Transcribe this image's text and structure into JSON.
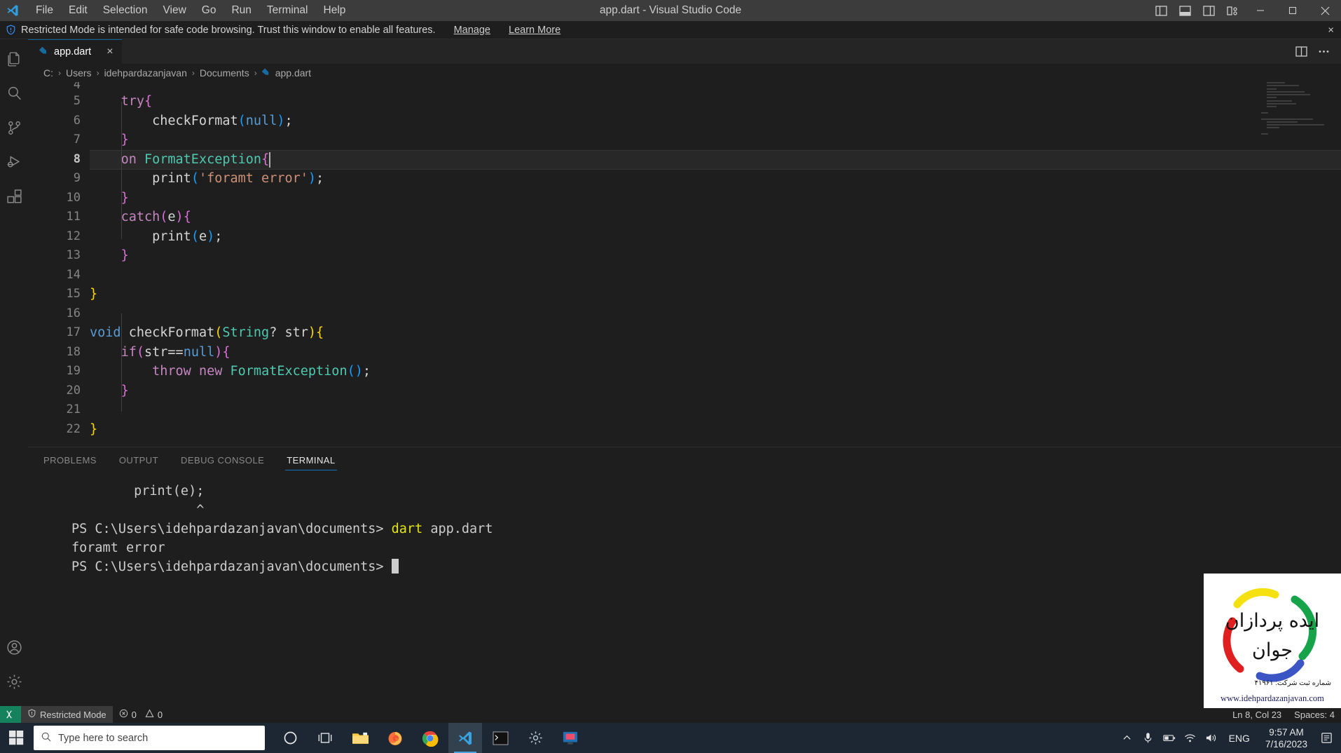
{
  "titlebar": {
    "window_title": "app.dart - Visual Studio Code",
    "menu": [
      "File",
      "Edit",
      "Selection",
      "View",
      "Go",
      "Run",
      "Terminal",
      "Help"
    ],
    "layout_icons": [
      "toggle-primary-sidebar-icon",
      "toggle-panel-icon",
      "toggle-secondary-sidebar-icon",
      "customize-layout-icon"
    ],
    "window_controls": [
      "minimize",
      "maximize",
      "close"
    ]
  },
  "notification": {
    "icon": "shield-icon",
    "message": "Restricted Mode is intended for safe code browsing. Trust this window to enable all features.",
    "manage_label": "Manage",
    "learn_more_label": "Learn More",
    "close_label": "×"
  },
  "activitybar": {
    "items": [
      {
        "name": "explorer",
        "icon": "files-icon"
      },
      {
        "name": "search",
        "icon": "search-icon"
      },
      {
        "name": "source-control",
        "icon": "source-control-icon"
      },
      {
        "name": "run-and-debug",
        "icon": "debug-icon"
      },
      {
        "name": "extensions",
        "icon": "extensions-icon"
      }
    ],
    "bottom_items": [
      {
        "name": "accounts",
        "icon": "account-icon"
      },
      {
        "name": "settings",
        "icon": "gear-icon"
      }
    ]
  },
  "tabs": {
    "open": [
      {
        "label": "app.dart",
        "icon": "dart-file-icon",
        "active": true,
        "close": "×"
      }
    ],
    "actions": [
      "split-editor-icon",
      "more-actions-icon"
    ]
  },
  "breadcrumb": {
    "segments": [
      "C:",
      "Users",
      "idehpardazanjavan",
      "Documents"
    ],
    "file": "app.dart",
    "separator": "›"
  },
  "editor": {
    "active_line": 8,
    "first_partial_line": "4",
    "lines": [
      {
        "n": "5",
        "tokens": [
          {
            "t": "    ",
            "c": "t-plain"
          },
          {
            "t": "try",
            "c": "t-key"
          },
          {
            "t": "{",
            "c": "p-p"
          }
        ]
      },
      {
        "n": "6",
        "tokens": [
          {
            "t": "        ",
            "c": "t-plain"
          },
          {
            "t": "checkFormat",
            "c": "t-plain"
          },
          {
            "t": "(",
            "c": "p-b"
          },
          {
            "t": "null",
            "c": "t-kw2"
          },
          {
            "t": ")",
            "c": "p-b"
          },
          {
            "t": ";",
            "c": "t-plain"
          }
        ]
      },
      {
        "n": "7",
        "tokens": [
          {
            "t": "    ",
            "c": "t-plain"
          },
          {
            "t": "}",
            "c": "p-p"
          }
        ]
      },
      {
        "n": "8",
        "tokens": [
          {
            "t": "    ",
            "c": "t-plain"
          },
          {
            "t": "on",
            "c": "t-key"
          },
          {
            "t": " ",
            "c": "t-plain"
          },
          {
            "t": "FormatException",
            "c": "t-type"
          },
          {
            "t": "{",
            "c": "p-p"
          }
        ]
      },
      {
        "n": "9",
        "tokens": [
          {
            "t": "        ",
            "c": "t-plain"
          },
          {
            "t": "print",
            "c": "t-plain"
          },
          {
            "t": "(",
            "c": "p-b"
          },
          {
            "t": "'foramt error'",
            "c": "t-str"
          },
          {
            "t": ")",
            "c": "p-b"
          },
          {
            "t": ";",
            "c": "t-plain"
          }
        ]
      },
      {
        "n": "10",
        "tokens": [
          {
            "t": "    ",
            "c": "t-plain"
          },
          {
            "t": "}",
            "c": "p-p"
          }
        ]
      },
      {
        "n": "11",
        "tokens": [
          {
            "t": "    ",
            "c": "t-plain"
          },
          {
            "t": "catch",
            "c": "t-key"
          },
          {
            "t": "(",
            "c": "p-p"
          },
          {
            "t": "e",
            "c": "t-plain"
          },
          {
            "t": ")",
            "c": "p-p"
          },
          {
            "t": "{",
            "c": "p-p"
          }
        ]
      },
      {
        "n": "12",
        "tokens": [
          {
            "t": "        ",
            "c": "t-plain"
          },
          {
            "t": "print",
            "c": "t-plain"
          },
          {
            "t": "(",
            "c": "p-b"
          },
          {
            "t": "e",
            "c": "t-plain"
          },
          {
            "t": ")",
            "c": "p-b"
          },
          {
            "t": ";",
            "c": "t-plain"
          }
        ]
      },
      {
        "n": "13",
        "tokens": [
          {
            "t": "    ",
            "c": "t-plain"
          },
          {
            "t": "}",
            "c": "p-p"
          }
        ]
      },
      {
        "n": "14",
        "tokens": []
      },
      {
        "n": "15",
        "tokens": [
          {
            "t": "}",
            "c": "p-y"
          }
        ]
      },
      {
        "n": "16",
        "tokens": []
      },
      {
        "n": "17",
        "tokens": [
          {
            "t": "void",
            "c": "t-kw2"
          },
          {
            "t": " checkFormat",
            "c": "t-plain"
          },
          {
            "t": "(",
            "c": "p-y"
          },
          {
            "t": "String",
            "c": "t-type"
          },
          {
            "t": "? str",
            "c": "t-plain"
          },
          {
            "t": ")",
            "c": "p-y"
          },
          {
            "t": "{",
            "c": "p-y"
          }
        ]
      },
      {
        "n": "18",
        "tokens": [
          {
            "t": "    ",
            "c": "t-plain"
          },
          {
            "t": "if",
            "c": "t-key"
          },
          {
            "t": "(",
            "c": "p-p"
          },
          {
            "t": "str==",
            "c": "t-plain"
          },
          {
            "t": "null",
            "c": "t-kw2"
          },
          {
            "t": ")",
            "c": "p-p"
          },
          {
            "t": "{",
            "c": "p-p"
          }
        ]
      },
      {
        "n": "19",
        "tokens": [
          {
            "t": "        ",
            "c": "t-plain"
          },
          {
            "t": "throw",
            "c": "t-key"
          },
          {
            "t": " ",
            "c": "t-plain"
          },
          {
            "t": "new",
            "c": "t-key"
          },
          {
            "t": " ",
            "c": "t-plain"
          },
          {
            "t": "FormatException",
            "c": "t-type"
          },
          {
            "t": "(",
            "c": "p-b"
          },
          {
            "t": ")",
            "c": "p-b"
          },
          {
            "t": ";",
            "c": "t-plain"
          }
        ]
      },
      {
        "n": "20",
        "tokens": [
          {
            "t": "    ",
            "c": "t-plain"
          },
          {
            "t": "}",
            "c": "p-p"
          }
        ]
      },
      {
        "n": "21",
        "tokens": []
      },
      {
        "n": "22",
        "tokens": [
          {
            "t": "}",
            "c": "p-y"
          }
        ]
      }
    ]
  },
  "panel": {
    "tabs": [
      {
        "label": "PROBLEMS",
        "active": false
      },
      {
        "label": "OUTPUT",
        "active": false
      },
      {
        "label": "DEBUG CONSOLE",
        "active": false
      },
      {
        "label": "TERMINAL",
        "active": true
      }
    ],
    "terminal_lines": [
      {
        "segments": [
          {
            "t": "        print(e);",
            "c": ""
          }
        ]
      },
      {
        "segments": [
          {
            "t": "                ^",
            "c": ""
          }
        ]
      },
      {
        "segments": [
          {
            "t": "PS C:\\Users\\idehpardazanjavan\\documents> ",
            "c": ""
          },
          {
            "t": "dart",
            "c": "term-yellow"
          },
          {
            "t": " app.dart",
            "c": ""
          }
        ]
      },
      {
        "segments": [
          {
            "t": "foramt error",
            "c": ""
          }
        ]
      },
      {
        "segments": [
          {
            "t": "PS C:\\Users\\idehpardazanjavan\\documents> ",
            "c": ""
          }
        ],
        "cursor": true
      }
    ]
  },
  "statusbar": {
    "remote_icon": "remote-window-icon",
    "restricted_label": "Restricted Mode",
    "restricted_icon": "shield-icon",
    "errors_icon": "error-icon",
    "errors_count": "0",
    "warnings_icon": "warning-icon",
    "warnings_count": "0",
    "position": "Ln 8, Col 23",
    "spaces": "Spaces: 4"
  },
  "taskbar": {
    "start_icon": "windows-start-icon",
    "search_placeholder": "Type here to search",
    "search_icon": "search-icon",
    "pinned": [
      {
        "name": "cortana-icon"
      },
      {
        "name": "task-view-icon"
      },
      {
        "name": "file-explorer-icon"
      },
      {
        "name": "firefox-icon"
      },
      {
        "name": "chrome-icon"
      },
      {
        "name": "vscode-icon",
        "active": true
      },
      {
        "name": "terminal-icon"
      },
      {
        "name": "settings-app-icon"
      },
      {
        "name": "media-app-icon"
      }
    ],
    "tray": {
      "chevron": "show-hidden-icons-icon",
      "mic": "microphone-icon",
      "battery": "battery-icon",
      "wifi": "wifi-icon",
      "volume": "volume-icon",
      "language": "ENG",
      "time": "9:57 AM",
      "date": "7/16/2023",
      "notifications": "action-center-icon"
    }
  },
  "watermark": {
    "line1": "ایده پردازان",
    "line2": "جوان",
    "registration": "شماره ثبت شرکت: ۴۱۹۶۱",
    "url": "www.idehpardazanjavan.com",
    "colors": {
      "yellow": "#f5e010",
      "green": "#17a34a",
      "red": "#e02020",
      "blue": "#3b55c4"
    }
  }
}
